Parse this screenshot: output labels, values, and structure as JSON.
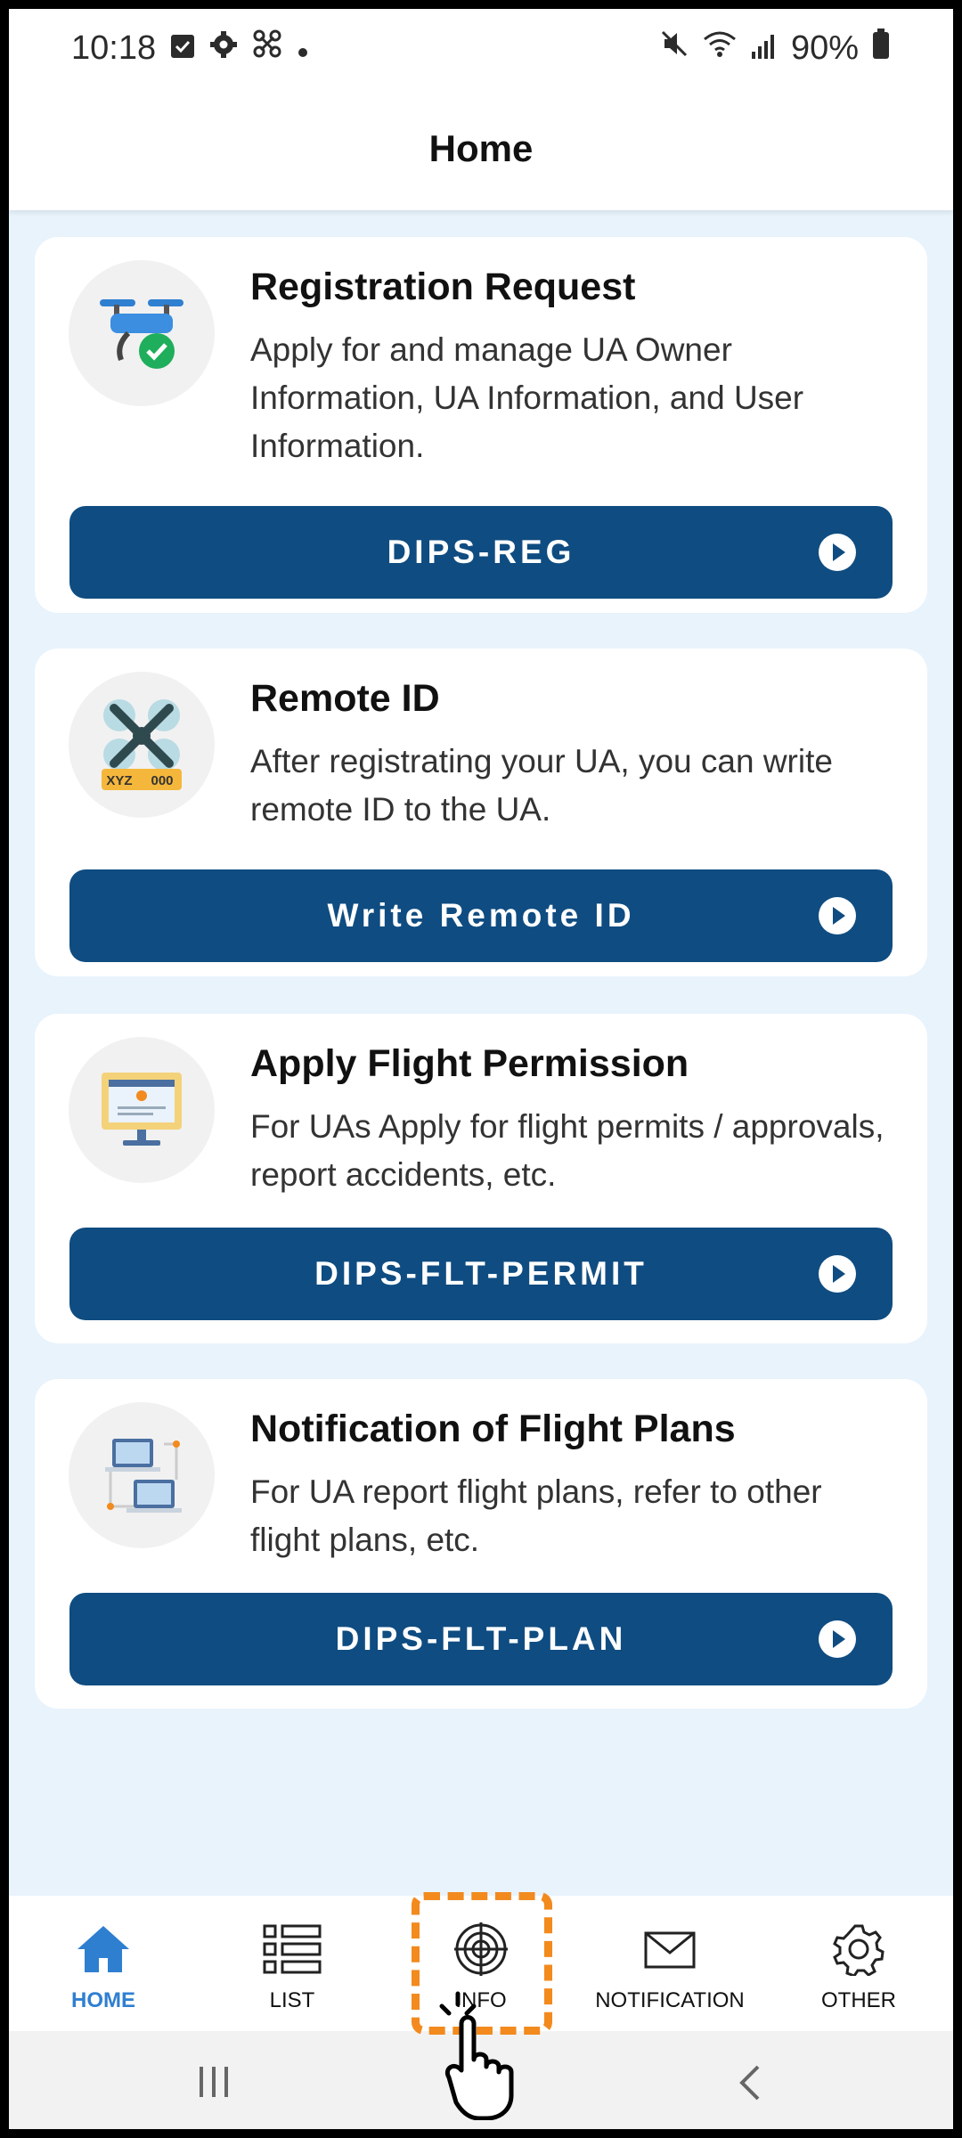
{
  "status": {
    "time": "10:18",
    "battery": "90%"
  },
  "header": {
    "title": "Home"
  },
  "cards": [
    {
      "title": "Registration Request",
      "description": "Apply for and manage UA Owner Information, UA Information, and User Information.",
      "button": "DIPS-REG",
      "icon": "drone-check-icon"
    },
    {
      "title": "Remote ID",
      "description": "After registrating your UA, you can write remote ID to the UA.",
      "button": "Write Remote ID",
      "icon": "drone-remote-id-icon",
      "icon_text": [
        "XYZ",
        "000"
      ]
    },
    {
      "title": "Apply Flight Permission",
      "description": "For UAs Apply for flight permits / approvals, report accidents, etc.",
      "button": "DIPS-FLT-PERMIT",
      "icon": "monitor-icon"
    },
    {
      "title": "Notification of Flight Plans",
      "description": "For UA report flight plans, refer to other flight plans, etc.",
      "button": "DIPS-FLT-PLAN",
      "icon": "network-computers-icon"
    }
  ],
  "nav": [
    {
      "label": "HOME",
      "icon": "home-icon",
      "active": true
    },
    {
      "label": "LIST",
      "icon": "list-icon",
      "active": false
    },
    {
      "label": "INFO",
      "icon": "target-icon",
      "active": false
    },
    {
      "label": "NOTIFICATION",
      "icon": "mail-icon",
      "active": false
    },
    {
      "label": "OTHER",
      "icon": "gear-icon",
      "active": false
    }
  ],
  "colors": {
    "primary": "#0f4c81",
    "active_nav": "#2f7fd1",
    "background": "#e8f3fc",
    "highlight": "#f28a1e"
  }
}
